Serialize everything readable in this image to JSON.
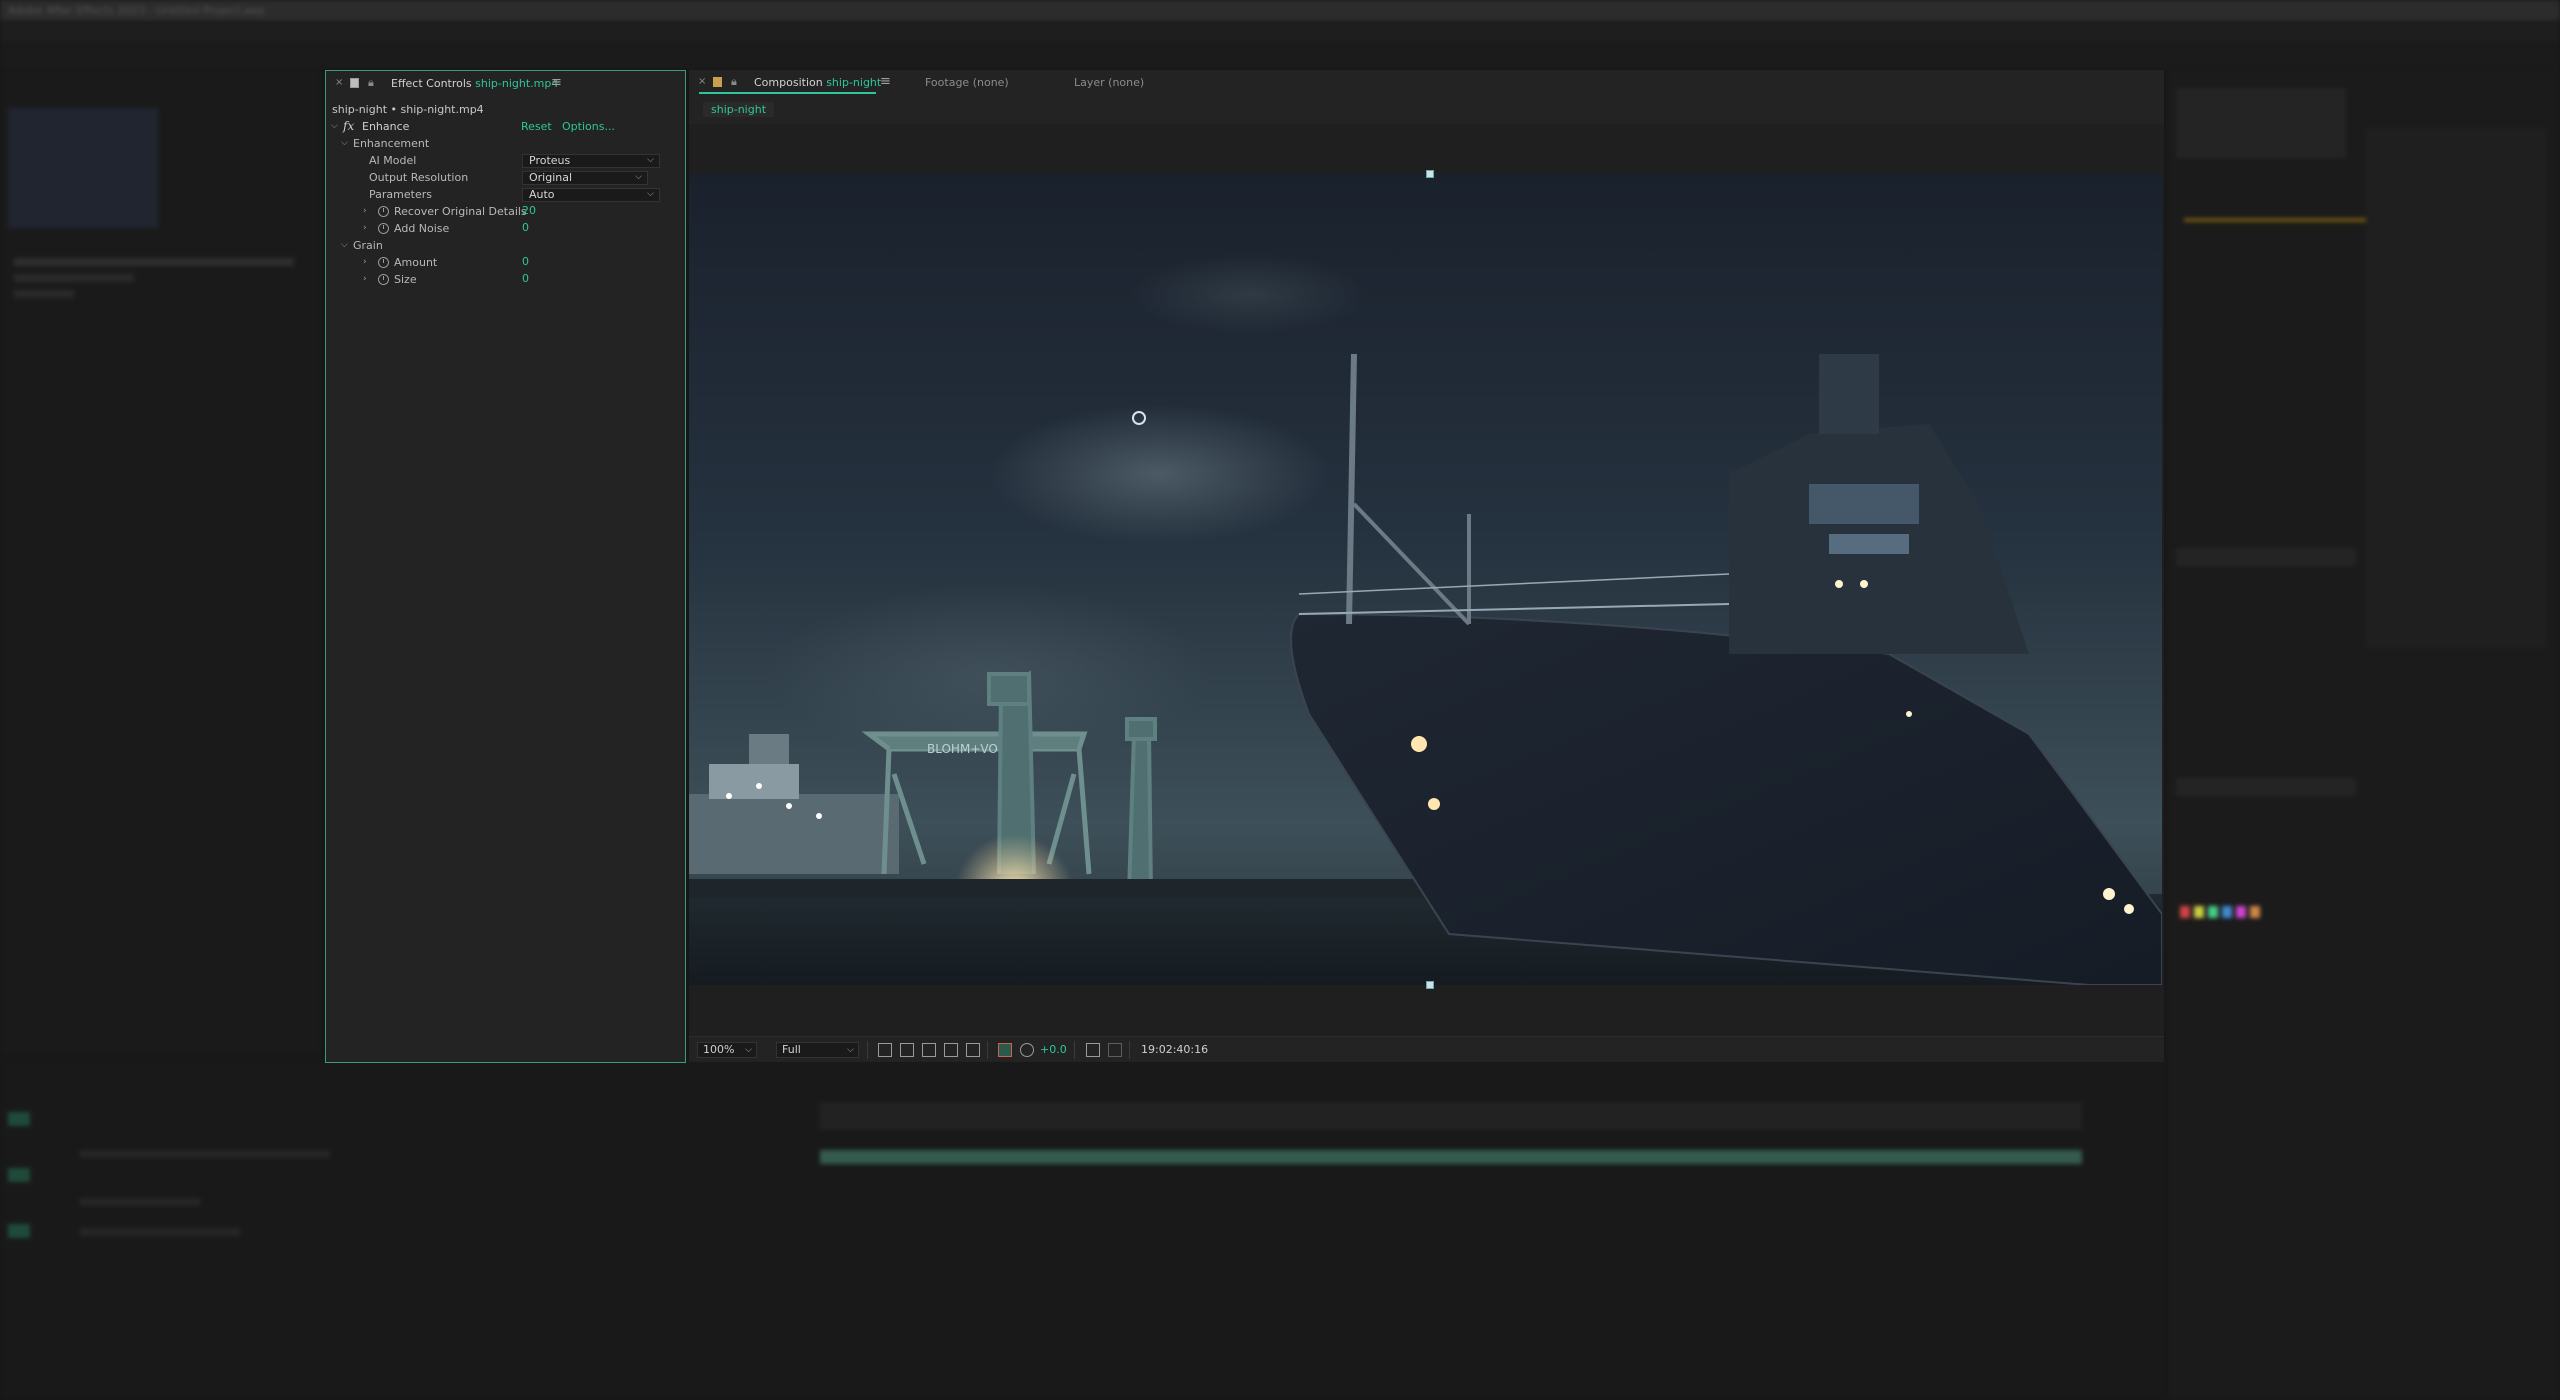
{
  "window": {
    "title": "Adobe After Effects 2023 - Untitled Project.aep"
  },
  "effect_controls": {
    "tab_title": "Effect Controls",
    "tab_layer": "ship-night.mp4",
    "source_label": "ship-night • ship-night.mp4",
    "effect": {
      "name": "Enhance",
      "reset_label": "Reset",
      "options_label": "Options...",
      "group_enhancement": "Enhancement",
      "ai_model_label": "AI Model",
      "ai_model_value": "Proteus",
      "output_resolution_label": "Output Resolution",
      "output_resolution_value": "Original",
      "parameters_label": "Parameters",
      "parameters_value": "Auto",
      "recover_label": "Recover Original Details",
      "recover_value": "20",
      "add_noise_label": "Add Noise",
      "add_noise_value": "0",
      "group_grain": "Grain",
      "amount_label": "Amount",
      "amount_value": "0",
      "size_label": "Size",
      "size_value": "0"
    }
  },
  "composition": {
    "tab_title": "Composition",
    "tab_comp": "ship-night",
    "footage_tab": "Footage (none)",
    "layer_tab": "Layer (none)",
    "subtab": "ship-night",
    "gantry_text": "BLOHM+VOSS"
  },
  "viewer_bar": {
    "zoom": "100%",
    "resolution": "Full",
    "exposure": "+0.0",
    "timecode": "19:02:40:16"
  },
  "icons": {
    "close": "close-icon",
    "lock": "lock-icon",
    "menu": "menu-icon",
    "stopwatch": "stopwatch-icon",
    "camera": "snapshot-icon"
  },
  "colors": {
    "accent": "#2fc59b",
    "panel_border": "#3a9a7a",
    "panel_bg": "#232323"
  }
}
